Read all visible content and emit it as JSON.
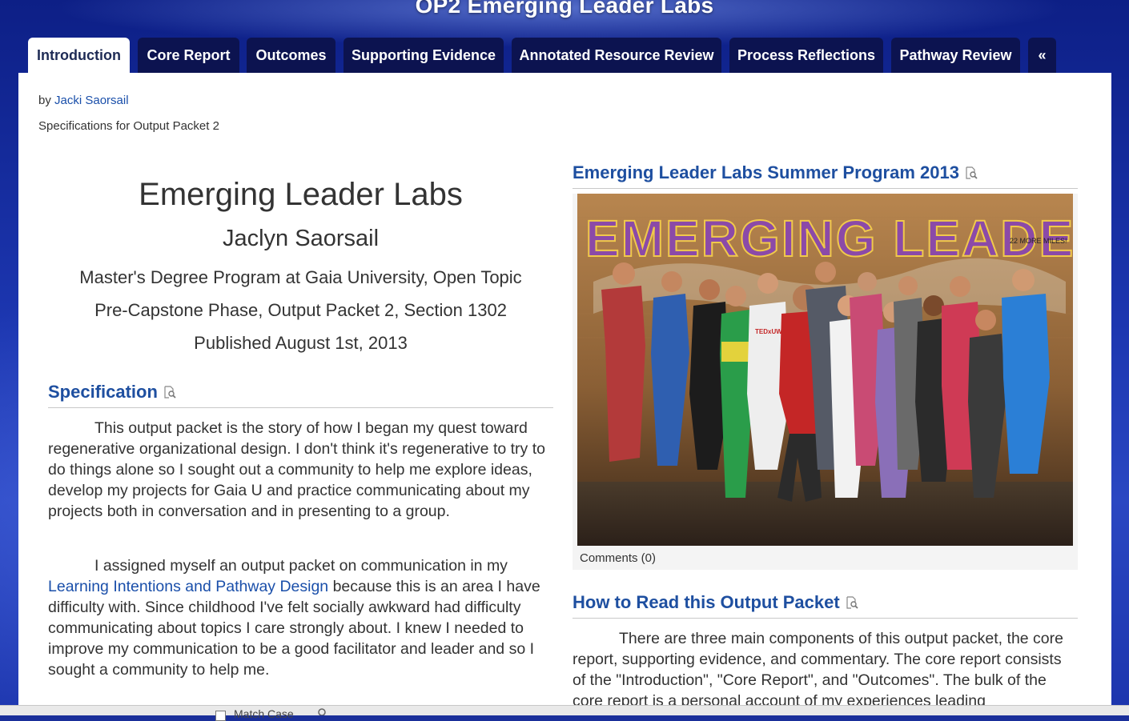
{
  "site": {
    "title": "OP2 Emerging Leader Labs"
  },
  "tabs": [
    {
      "label": "Introduction",
      "active": true
    },
    {
      "label": "Core Report"
    },
    {
      "label": "Outcomes"
    },
    {
      "label": "Supporting Evidence"
    },
    {
      "label": "Annotated Resource Review"
    },
    {
      "label": "Process Reflections"
    },
    {
      "label": "Pathway Review"
    },
    {
      "label": "«"
    }
  ],
  "meta": {
    "by_prefix": "by",
    "author": "Jacki Saorsail",
    "description": "Specifications for Output Packet 2"
  },
  "header": {
    "title": "Emerging Leader Labs",
    "name": "Jaclyn Saorsail",
    "line1": "Master's Degree Program at Gaia University, Open Topic",
    "line2": "Pre-Capstone Phase, Output Packet 2, Section 1302",
    "line3": "Published August 1st, 2013"
  },
  "specification": {
    "heading": "Specification",
    "para1": "This output packet is the story of how I began my quest toward regenerative organizational design. I don't think it's regenerative to try to do things alone so I sought out a community to help me explore ideas, develop my projects for Gaia U and practice communicating about my projects both in conversation and in presenting to a group.",
    "para2_before_link": "I assigned myself an output packet on communication in my",
    "para2_link": "Learning Intentions and Pathway Design",
    "para2_after_link": "because this is an area I have difficulty with.  Since childhood I've felt socially awkward had difficulty communicating about topics I care strongly about.  I knew I needed to improve my communication to be a good facilitator and leader and so I sought a community to help me."
  },
  "summer_program": {
    "heading": "Emerging Leader Labs Summer Program 2013",
    "mural_text": "EMERGING LEADERS",
    "mural_note": "22 MORE MILES!",
    "shirt_text": "TEDxUW",
    "comments": "Comments (0)"
  },
  "how_to_read": {
    "heading": "How to Read this Output Packet",
    "para": "There are three main components of this output packet, the core report, supporting evidence, and commentary.  The core report consists of the \"Introduction\", \"Core Report\", and \"Outcomes\".  The bulk of the core report is a personal account of my experiences leading"
  },
  "findbar": {
    "match_case_label": "Match Case"
  },
  "colors": {
    "tab_bg": "#0c1350",
    "heading_blue": "#1e4fa0",
    "link_blue": "#1a4faa",
    "text": "#333333"
  },
  "icons": [
    "magnifier-page-icon"
  ]
}
